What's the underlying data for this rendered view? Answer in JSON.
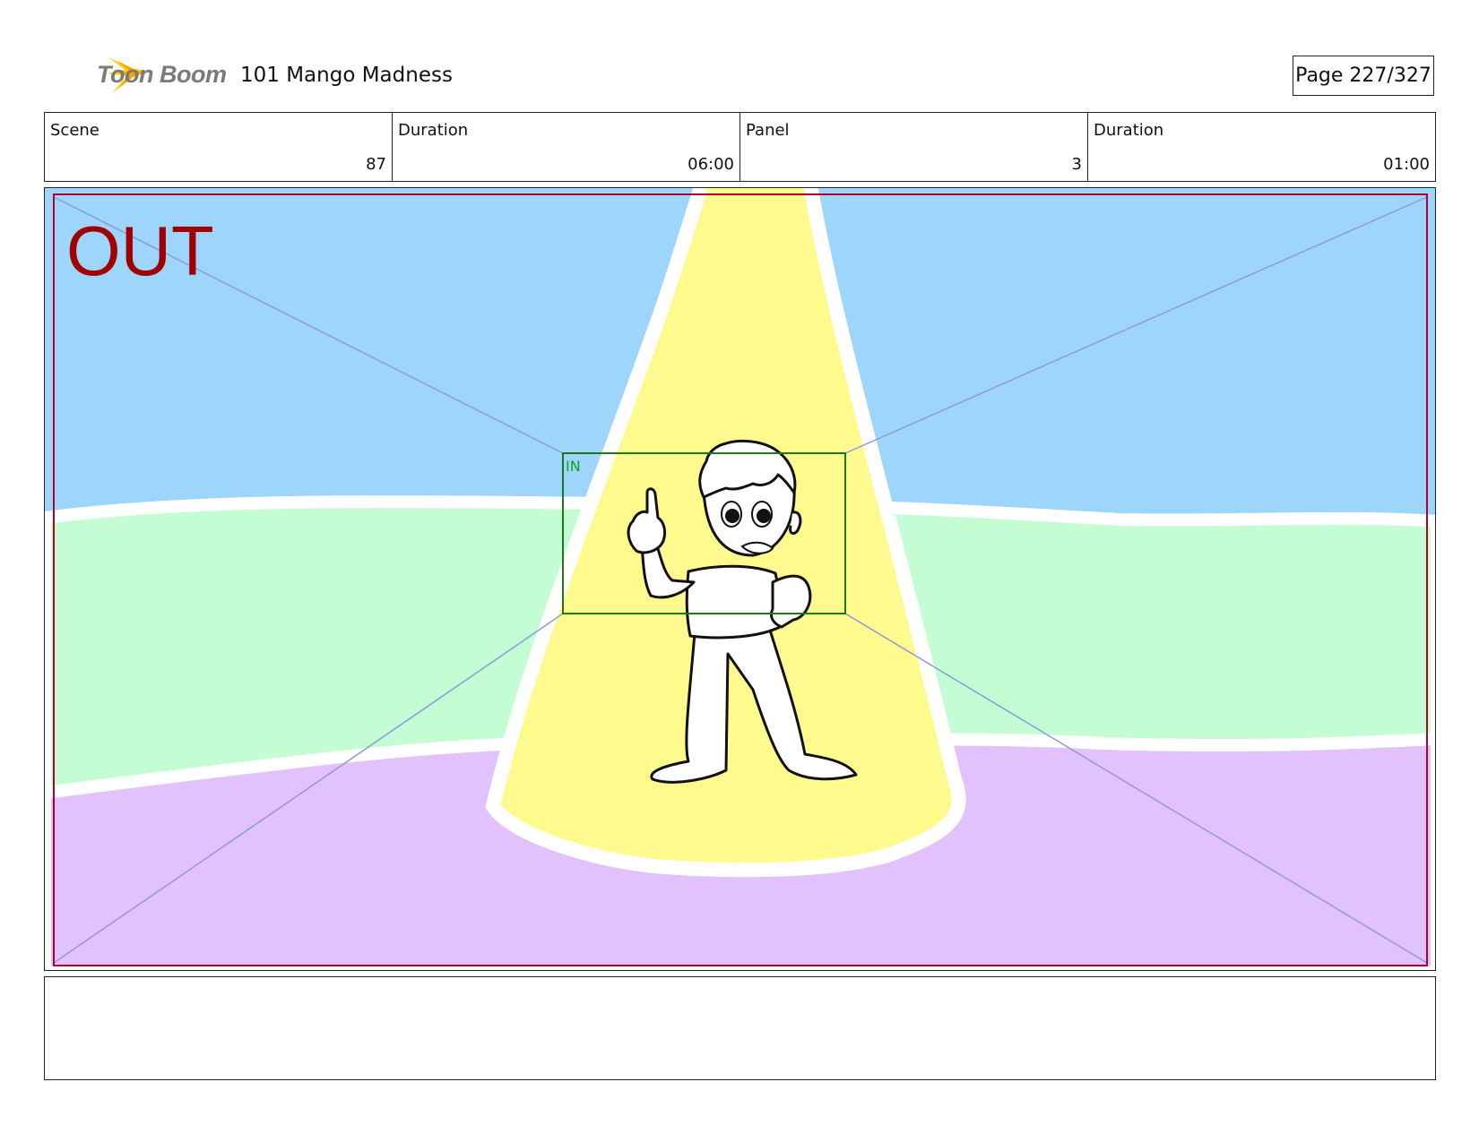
{
  "header": {
    "logo_text": "Toon Boom",
    "project_title": "101 Mango Madness",
    "page_label": "Page 227/327"
  },
  "info_bar": [
    {
      "label": "Scene",
      "value": "87"
    },
    {
      "label": "Duration",
      "value": "06:00"
    },
    {
      "label": "Panel",
      "value": "3"
    },
    {
      "label": "Duration",
      "value": "01:00"
    }
  ],
  "panel": {
    "out_label": "OUT",
    "in_label": "IN",
    "colors": {
      "sky": "#9dd5fb",
      "grass": "#c4fcd4",
      "floor": "#e2c2fc",
      "spotlight": "#fffa8e",
      "out_frame": "#b0002a",
      "in_frame": "#1a7a1a",
      "out_text": "#a00000"
    }
  },
  "notes": {
    "text": ""
  }
}
